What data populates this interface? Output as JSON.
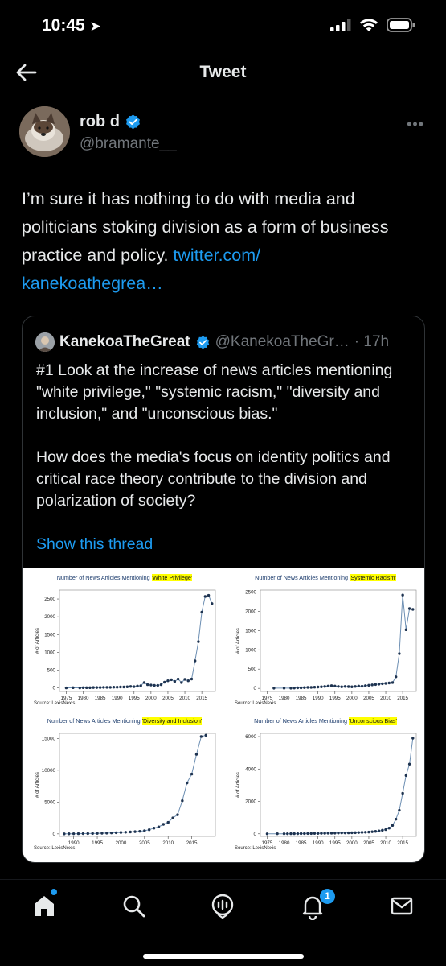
{
  "status_bar": {
    "time": "10:45"
  },
  "nav": {
    "title": "Tweet"
  },
  "author": {
    "name": "rob d",
    "handle": "@bramante__"
  },
  "tweet": {
    "text": "I’m sure it has nothing to do with media and politicians stoking division as a form of business practice and policy. ",
    "link_line1": "twitter.com/",
    "link_line2": "kanekoathegrea…"
  },
  "quote": {
    "name": "KanekoaTheGreat",
    "handle": "@KanekoaTheGr…",
    "time": "· 17h",
    "paragraph1": "#1 Look at the increase of news articles mentioning \"white privilege,\" \"systemic racism,\" \"diversity and inclusion,\" and \"unconscious bias.\"",
    "paragraph2": "How does the media's focus on identity politics and critical race theory contribute to the division and polarization of society?",
    "show_thread": "Show this thread"
  },
  "chart_data": [
    {
      "type": "line",
      "title": "Number of News Articles Mentioning 'White Privilege'",
      "title_prefix": "Number of News Articles Mentioning ",
      "title_term": "'White Privilege'",
      "ylabel": "# of Articles",
      "source": "Source: LexisNexis",
      "xlim": [
        1973,
        2019
      ],
      "ylim": [
        -100,
        2750
      ],
      "xticks": [
        1975,
        1980,
        1985,
        1990,
        1995,
        2000,
        2005,
        2010,
        2015
      ],
      "yticks": [
        0,
        500,
        1000,
        1500,
        2000,
        2500
      ],
      "x": [
        1975,
        1977,
        1979,
        1980,
        1981,
        1982,
        1983,
        1984,
        1985,
        1986,
        1987,
        1988,
        1989,
        1990,
        1991,
        1992,
        1993,
        1994,
        1995,
        1996,
        1997,
        1998,
        1999,
        2000,
        2001,
        2002,
        2003,
        2004,
        2005,
        2006,
        2007,
        2008,
        2009,
        2010,
        2011,
        2012,
        2013,
        2014,
        2015,
        2016,
        2017,
        2018
      ],
      "y": [
        0,
        5,
        0,
        5,
        5,
        5,
        10,
        10,
        10,
        15,
        15,
        15,
        20,
        20,
        25,
        25,
        30,
        40,
        35,
        50,
        60,
        150,
        90,
        80,
        70,
        70,
        90,
        160,
        200,
        230,
        180,
        250,
        150,
        240,
        200,
        250,
        760,
        1300,
        2130,
        2570,
        2600,
        2370
      ]
    },
    {
      "type": "line",
      "title": "Number of News Articles Mentioning 'Systemic Racism'",
      "title_prefix": "Number of News Articles Mentioning ",
      "title_term": "'Systemic Racism'",
      "ylabel": "# of Articles",
      "source": "Source: LexisNexis",
      "xlim": [
        1973,
        2019
      ],
      "ylim": [
        -80,
        2550
      ],
      "xticks": [
        1975,
        1980,
        1985,
        1990,
        1995,
        2000,
        2005,
        2010,
        2015
      ],
      "yticks": [
        0,
        500,
        1000,
        1500,
        2000,
        2500
      ],
      "x": [
        1977,
        1980,
        1982,
        1983,
        1984,
        1985,
        1986,
        1987,
        1988,
        1989,
        1990,
        1991,
        1992,
        1993,
        1994,
        1995,
        1996,
        1997,
        1998,
        1999,
        2000,
        2001,
        2002,
        2003,
        2004,
        2005,
        2006,
        2007,
        2008,
        2009,
        2010,
        2011,
        2012,
        2013,
        2014,
        2015,
        2016,
        2017,
        2018
      ],
      "y": [
        5,
        5,
        5,
        10,
        15,
        15,
        20,
        25,
        25,
        30,
        35,
        40,
        50,
        60,
        70,
        60,
        50,
        40,
        50,
        45,
        40,
        50,
        60,
        55,
        70,
        80,
        90,
        100,
        110,
        120,
        130,
        140,
        150,
        300,
        900,
        2420,
        1520,
        2070,
        2050
      ]
    },
    {
      "type": "line",
      "title": "Number of News Articles Mentioning 'Diversity and Inclusion'",
      "title_prefix": "Number of News Articles Mentioning ",
      "title_term": "'Diversity and Inclusion'",
      "ylabel": "# of Articles",
      "source": "Source: LexisNexis",
      "xlim": [
        1987,
        2020
      ],
      "ylim": [
        -400,
        15800
      ],
      "xticks": [
        1990,
        1995,
        2000,
        2005,
        2010,
        2015
      ],
      "yticks": [
        0,
        5000,
        10000,
        15000
      ],
      "x": [
        1988,
        1989,
        1990,
        1991,
        1992,
        1993,
        1994,
        1995,
        1996,
        1997,
        1998,
        1999,
        2000,
        2001,
        2002,
        2003,
        2004,
        2005,
        2006,
        2007,
        2008,
        2009,
        2010,
        2011,
        2012,
        2013,
        2014,
        2015,
        2016,
        2017,
        2018
      ],
      "y": [
        0,
        10,
        20,
        30,
        40,
        50,
        60,
        80,
        100,
        120,
        150,
        180,
        220,
        260,
        300,
        350,
        400,
        500,
        650,
        900,
        1100,
        1500,
        1800,
        2500,
        3000,
        5200,
        8000,
        9400,
        12500,
        15300,
        15500
      ]
    },
    {
      "type": "line",
      "title": "Number of News Articles Mentioning 'Unconscious Bias'",
      "title_prefix": "Number of News Articles Mentioning ",
      "title_term": "'Unconscious Bias'",
      "ylabel": "# of Articles",
      "source": "Source: LexisNexis",
      "xlim": [
        1973,
        2019
      ],
      "ylim": [
        -160,
        6200
      ],
      "xticks": [
        1975,
        1980,
        1985,
        1990,
        1995,
        2000,
        2005,
        2010,
        2015
      ],
      "yticks": [
        0,
        2000,
        4000,
        6000
      ],
      "x": [
        1975,
        1978,
        1980,
        1981,
        1982,
        1983,
        1984,
        1985,
        1986,
        1987,
        1988,
        1989,
        1990,
        1991,
        1992,
        1993,
        1994,
        1995,
        1996,
        1997,
        1998,
        1999,
        2000,
        2001,
        2002,
        2003,
        2004,
        2005,
        2006,
        2007,
        2008,
        2009,
        2010,
        2011,
        2012,
        2013,
        2014,
        2015,
        2016,
        2017,
        2018
      ],
      "y": [
        0,
        5,
        5,
        5,
        10,
        10,
        10,
        15,
        15,
        20,
        20,
        25,
        25,
        30,
        35,
        40,
        40,
        45,
        50,
        55,
        55,
        60,
        65,
        70,
        80,
        90,
        100,
        110,
        130,
        150,
        180,
        220,
        260,
        350,
        520,
        900,
        1450,
        2500,
        3600,
        4300,
        5900
      ]
    }
  ],
  "tabbar": {
    "notifications_count": "1"
  }
}
